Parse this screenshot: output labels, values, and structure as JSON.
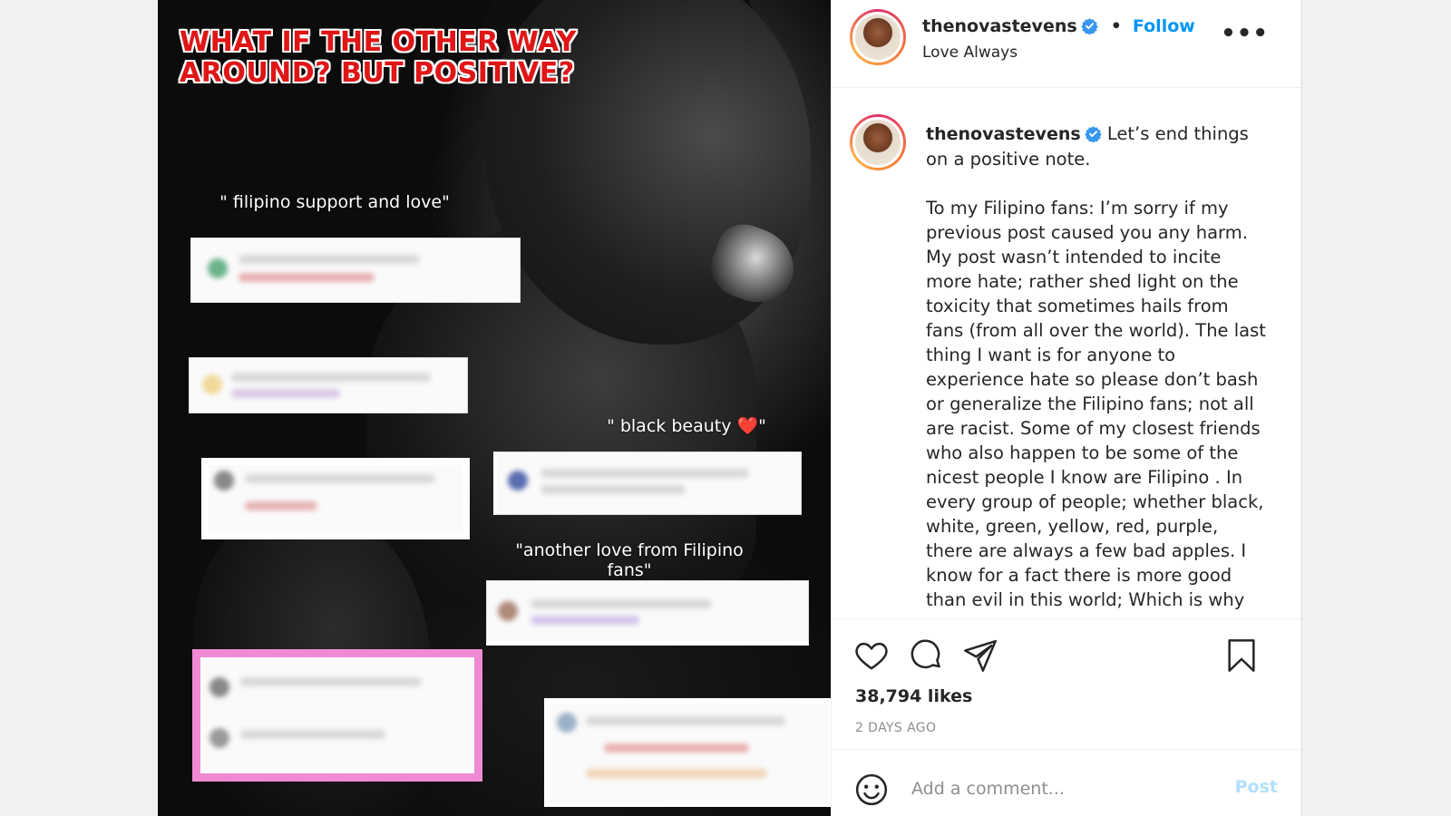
{
  "image": {
    "title": "WHAT IF THE OTHER WAY AROUND? BUT POSITIVE?",
    "captions": {
      "support": "\" filipino support and love\"",
      "black_beauty": "\" black beauty",
      "black_beauty_end": "\"",
      "heart": "❤️",
      "another_love": "\"another love from Filipino fans\""
    }
  },
  "post": {
    "username": "thenovastevens",
    "verified": true,
    "follow_label": "Follow",
    "dot": "•",
    "subtitle": "Love Always",
    "more_label": "•••",
    "caption_username": "thenovastevens",
    "caption_first": "Let’s end things on a positive note.",
    "caption_body": "To my Filipino fans: I’m sorry if my previous post caused you any harm. My post wasn’t intended to incite more hate; rather shed light on the toxicity that sometimes hails from fans (from all over the world). The last thing I want is for anyone to experience hate so please don’t bash or generalize the Filipino fans; not all are racist. Some of my closest friends who also happen to be some of the nicest people I know are Filipino . In every group of people; whether black, white, green, yellow, red, purple, there are always a few bad apples. I know for a fact there is more good than evil in this world; Which is why it’s important to shed light on the",
    "likes": "38,794 likes",
    "time_ago": "2 DAYS AGO",
    "comment_placeholder": "Add a comment...",
    "post_label": "Post"
  },
  "colors": {
    "accent": "#0095f6",
    "title_red": "#e01616",
    "highlight_pink": "#f08ad4",
    "post_disabled": "#b2dffc"
  },
  "icons": [
    "verified-badge-icon",
    "more-options-icon",
    "heart-icon",
    "comment-icon",
    "share-icon",
    "bookmark-icon",
    "emoji-icon"
  ]
}
